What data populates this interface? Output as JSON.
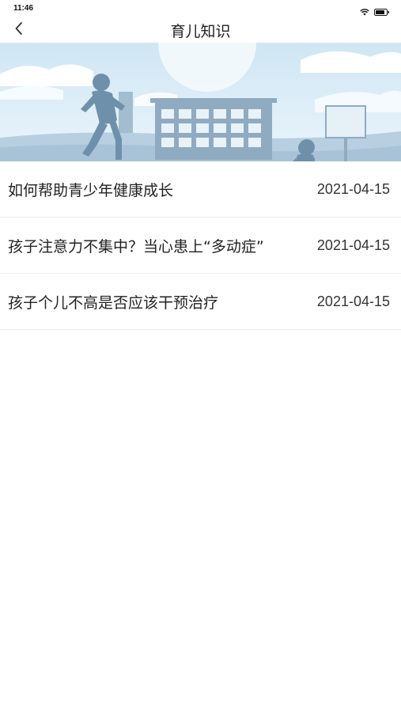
{
  "status_bar": {
    "time": "11:46",
    "icons": [
      "wifi-icon",
      "battery-icon"
    ]
  },
  "nav": {
    "back_icon": "chevron-left-icon",
    "title": "育儿知识"
  },
  "banner": {
    "image": "children-running-schoolyard-illustration"
  },
  "articles": [
    {
      "title": "如何帮助青少年健康成长",
      "date": "2021-04-15"
    },
    {
      "title": "孩子注意力不集中？当心患上“多动症”",
      "date": "2021-04-15"
    },
    {
      "title": "孩子个儿不高是否应该干预治疗",
      "date": "2021-04-15"
    }
  ],
  "colors": {
    "sky": "#dceef8",
    "silhouette": "#7f9fb8",
    "divider": "#ececec",
    "text": "#222222"
  }
}
